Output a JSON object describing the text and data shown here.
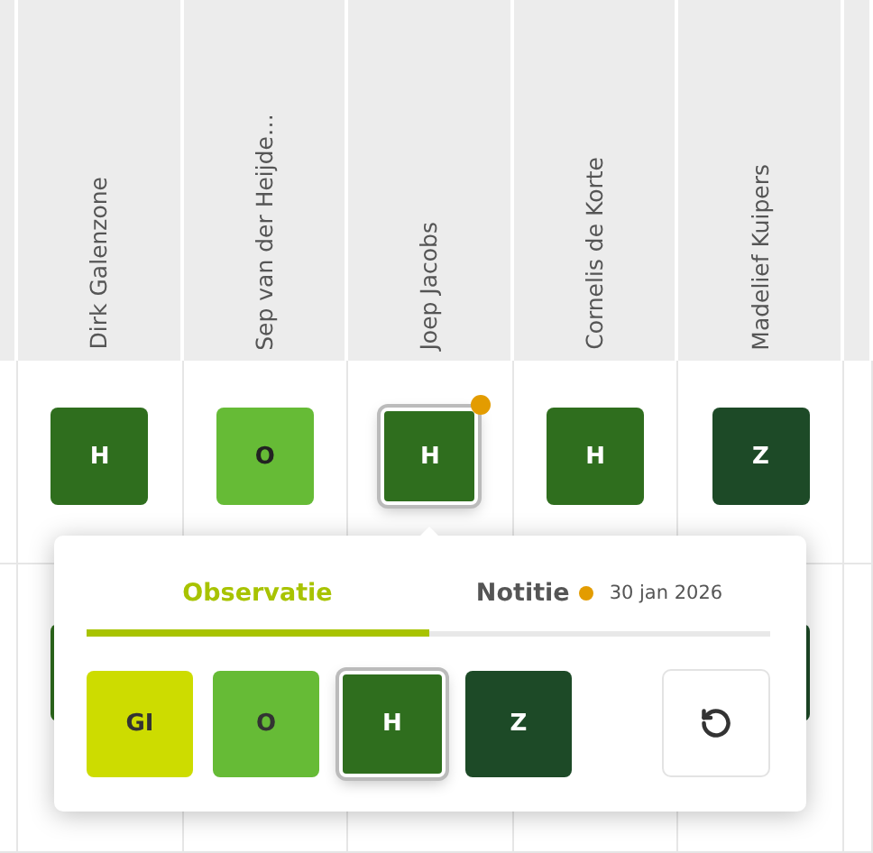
{
  "columns": [
    {
      "name": "Dirk Galenzone",
      "score": "H",
      "color": "#2f6e1e",
      "selected": false,
      "has_note": false,
      "next_row_tile": {
        "color": "#2f6e1e"
      }
    },
    {
      "name": "Sep van der Heijde…",
      "score": "O",
      "color": "#66bb36",
      "selected": false,
      "has_note": false
    },
    {
      "name": "Joep Jacobs",
      "score": "H",
      "color": "#2f6e1e",
      "selected": true,
      "has_note": true
    },
    {
      "name": "Cornelis de Korte",
      "score": "H",
      "color": "#2f6e1e",
      "selected": false,
      "has_note": false
    },
    {
      "name": "Madelief Kuipers",
      "score": "Z",
      "color": "#1d4a27",
      "selected": false,
      "has_note": false,
      "next_row_tile": {
        "color": "#1d4a27"
      }
    }
  ],
  "popover": {
    "tabs": [
      {
        "label": "Observatie",
        "selected": true,
        "has_note": false
      },
      {
        "label": "Notitie",
        "selected": false,
        "has_note": true,
        "date": "30 jan 2026"
      }
    ],
    "options": [
      {
        "label": "GI",
        "color": "#cddc00",
        "selected": false
      },
      {
        "label": "O",
        "color": "#66bb36",
        "selected": false
      },
      {
        "label": "H",
        "color": "#2f6e1e",
        "selected": true
      },
      {
        "label": "Z",
        "color": "#1d4a27",
        "selected": false
      }
    ]
  }
}
